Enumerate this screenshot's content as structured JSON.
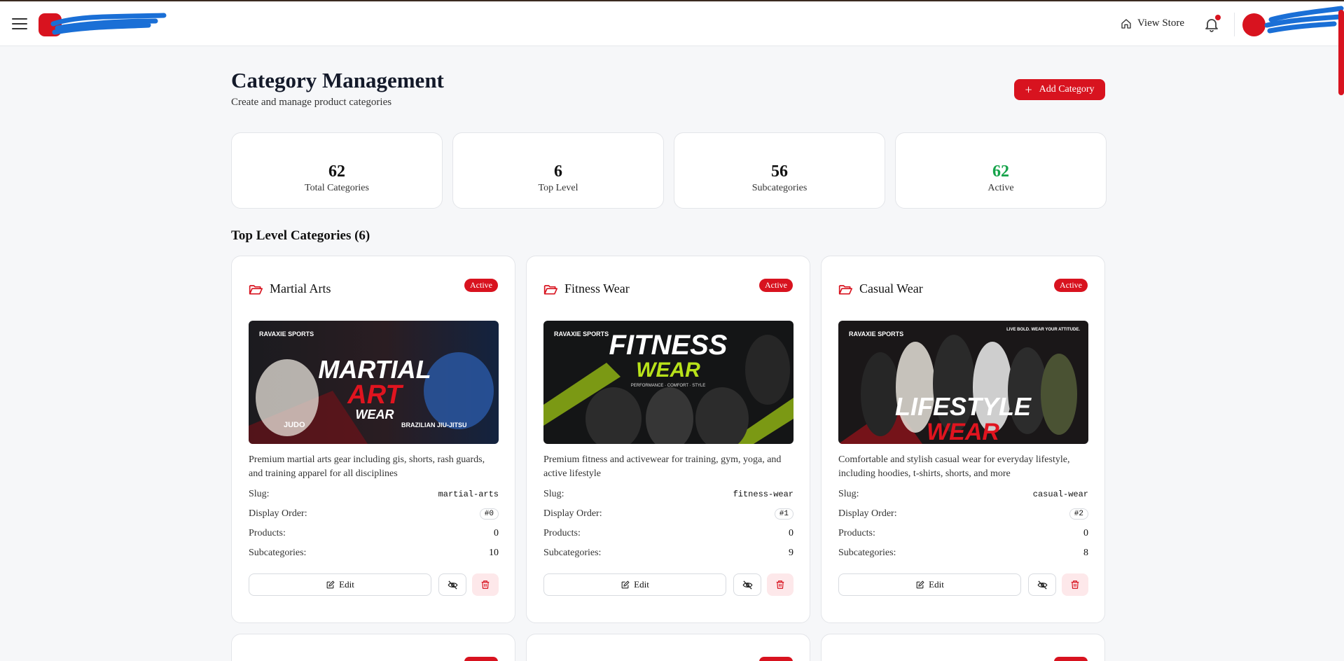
{
  "header": {
    "view_store_label": "View Store"
  },
  "page": {
    "title": "Category Management",
    "subtitle": "Create and manage product categories",
    "add_button_label": "Add Category"
  },
  "stats": [
    {
      "value": "62",
      "label": "Total Categories"
    },
    {
      "value": "6",
      "label": "Top Level"
    },
    {
      "value": "56",
      "label": "Subcategories"
    },
    {
      "value": "62",
      "label": "Active"
    }
  ],
  "section": {
    "title": "Top Level Categories (6)"
  },
  "labels": {
    "slug": "Slug:",
    "display_order": "Display Order:",
    "products": "Products:",
    "subcategories": "Subcategories:",
    "edit": "Edit"
  },
  "categories": [
    {
      "name": "Martial Arts",
      "status": "Active",
      "banner": {
        "brand": "RAVAXIE SPORTS",
        "line1": "MARTIAL",
        "line2": "ART",
        "line3": "WEAR",
        "tag_left": "JUDO",
        "tag_right": "BRAZILIAN JIU-JITSU"
      },
      "description": "Premium martial arts gear including gis, shorts, rash guards, and training apparel for all disciplines",
      "slug": "martial-arts",
      "display_order": "#0",
      "products": "0",
      "subcategories": "10"
    },
    {
      "name": "Fitness Wear",
      "status": "Active",
      "banner": {
        "brand": "RAVAXIE SPORTS",
        "line1": "FITNESS",
        "line2": "WEAR",
        "line3": "PERFORMANCE · COMFORT · STYLE",
        "tag_left": "",
        "tag_right": ""
      },
      "description": "Premium fitness and activewear for training, gym, yoga, and active lifestyle",
      "slug": "fitness-wear",
      "display_order": "#1",
      "products": "0",
      "subcategories": "9"
    },
    {
      "name": "Casual Wear",
      "status": "Active",
      "banner": {
        "brand": "RAVAXIE SPORTS",
        "line1": "LIFESTYLE",
        "line2": "WEAR",
        "line3": "",
        "tag_left": "",
        "tag_right": "LIVE BOLD. WEAR YOUR ATTITUDE."
      },
      "description": "Comfortable and stylish casual wear for everyday lifestyle, including hoodies, t-shirts, shorts, and more",
      "slug": "casual-wear",
      "display_order": "#2",
      "products": "0",
      "subcategories": "8"
    }
  ],
  "colors": {
    "accent": "#d8131f",
    "active_green": "#16a34a",
    "danger_bg": "#fde8ea"
  }
}
